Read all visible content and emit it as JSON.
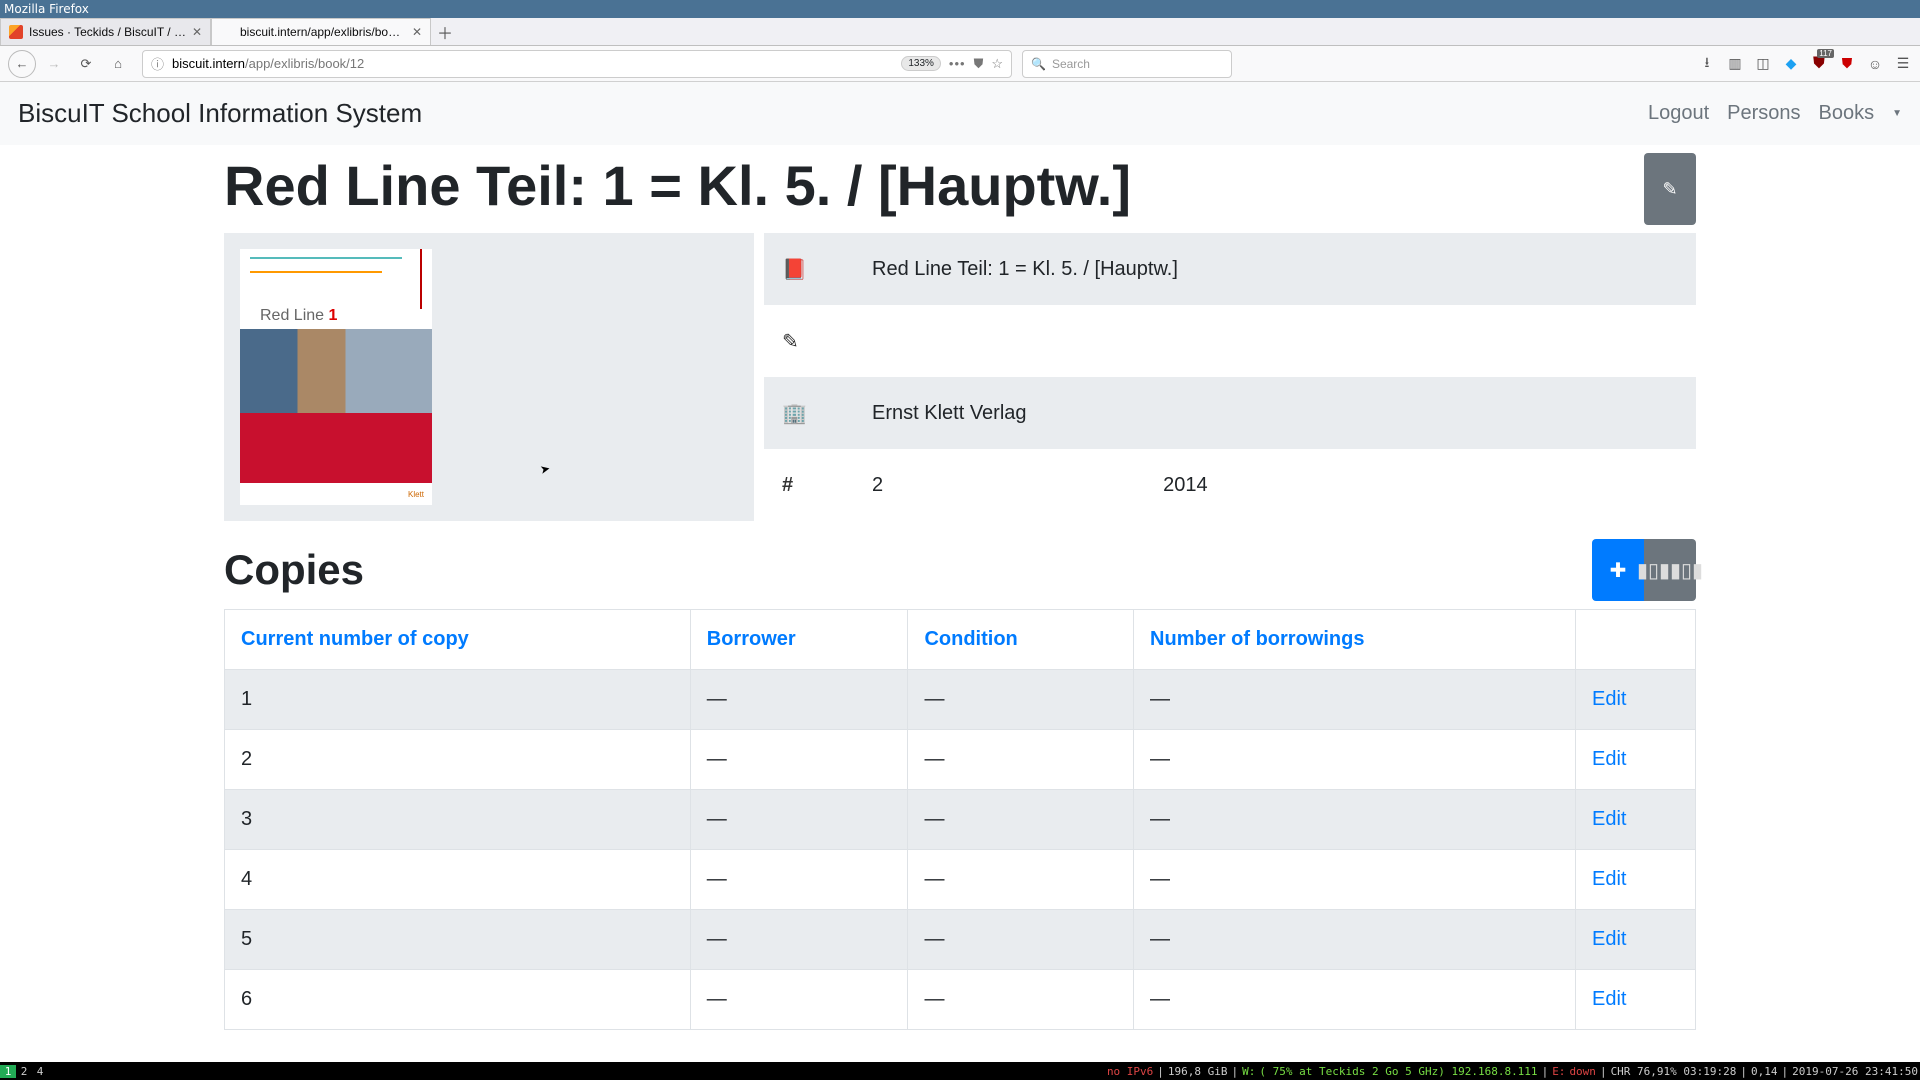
{
  "wm": {
    "title": "Mozilla Firefox"
  },
  "tabs": [
    {
      "title": "Issues · Teckids / BiscuIT / …",
      "favicon": "gitlab",
      "active": false
    },
    {
      "title": "biscuit.intern/app/exlibris/boo…",
      "favicon": "",
      "active": true
    }
  ],
  "urlbar": {
    "host": "biscuit.intern",
    "path": "/app/exlibris/book/12",
    "zoom": "133%",
    "search_placeholder": "Search"
  },
  "toolbar_badge": "117",
  "app": {
    "brand": "BiscuIT School Information System",
    "nav": {
      "logout": "Logout",
      "persons": "Persons",
      "books": "Books"
    },
    "book": {
      "title": "Red Line Teil: 1 = Kl. 5. / [Hauptw.]",
      "cover_text": "Red Line",
      "cover_num": "1",
      "meta_title": "Red Line Teil: 1 = Kl. 5. / [Hauptw.]",
      "publisher": "Ernst Klett Verlag",
      "edition": "2",
      "year": "2014"
    },
    "copies": {
      "heading": "Copies",
      "headers": {
        "copy": "Current number of copy",
        "borrower": "Borrower",
        "condition": "Condition",
        "borrowings": "Number of borrowings"
      },
      "rows": [
        {
          "n": "1",
          "borrower": "—",
          "condition": "—",
          "borrowings": "—",
          "action": "Edit"
        },
        {
          "n": "2",
          "borrower": "—",
          "condition": "—",
          "borrowings": "—",
          "action": "Edit"
        },
        {
          "n": "3",
          "borrower": "—",
          "condition": "—",
          "borrowings": "—",
          "action": "Edit"
        },
        {
          "n": "4",
          "borrower": "—",
          "condition": "—",
          "borrowings": "—",
          "action": "Edit"
        },
        {
          "n": "5",
          "borrower": "—",
          "condition": "—",
          "borrowings": "—",
          "action": "Edit"
        },
        {
          "n": "6",
          "borrower": "—",
          "condition": "—",
          "borrowings": "—",
          "action": "Edit"
        }
      ]
    }
  },
  "statusbar": {
    "workspaces": [
      "1",
      "2",
      "4"
    ],
    "active_ws": 0,
    "net": "no IPv6",
    "mem": "196,8 GiB",
    "wifi_label": "W:",
    "wifi": "( 75% at Teckids 2 Go 5 GHz) 192.168.8.111",
    "eth_label": "E:",
    "eth": " down",
    "chr": "CHR 76,91% 03:19:28",
    "load": "0,14",
    "date": "2019-07-26 23:41:50"
  }
}
